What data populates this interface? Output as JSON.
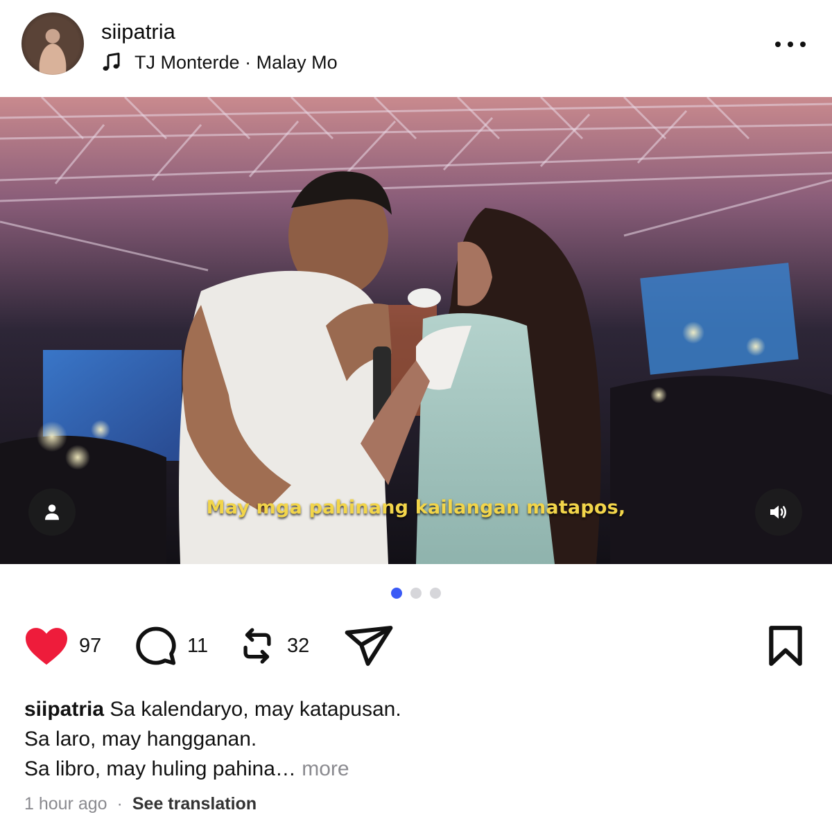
{
  "post": {
    "username": "siipatria",
    "music": {
      "icon": "music-note-icon",
      "artist": "TJ Monterde",
      "separator": "·",
      "song": "Malay Mo"
    },
    "more_icon": "more-horizontal-icon"
  },
  "media": {
    "subtitle": "May mga pahinang kailangan matapos,",
    "user_tag_icon": "user-icon",
    "sound_icon": "speaker-icon",
    "carousel": {
      "total": 3,
      "active_index": 0
    },
    "accent": "#3a5af6"
  },
  "actions": {
    "likes": "97",
    "comments": "11",
    "reposts": "32",
    "liked": true,
    "like_color": "#ee1c3b",
    "icons": [
      "heart-icon",
      "comment-icon",
      "repost-icon",
      "send-icon",
      "bookmark-icon"
    ]
  },
  "caption": {
    "username": "siipatria",
    "line1": "Sa kalendaryo, may katapusan.",
    "line2": "Sa laro, may hangganan.",
    "line3": "Sa libro, may huling pahina…",
    "more": "more"
  },
  "meta": {
    "time": "1 hour ago",
    "separator": "·",
    "translate": "See translation"
  }
}
